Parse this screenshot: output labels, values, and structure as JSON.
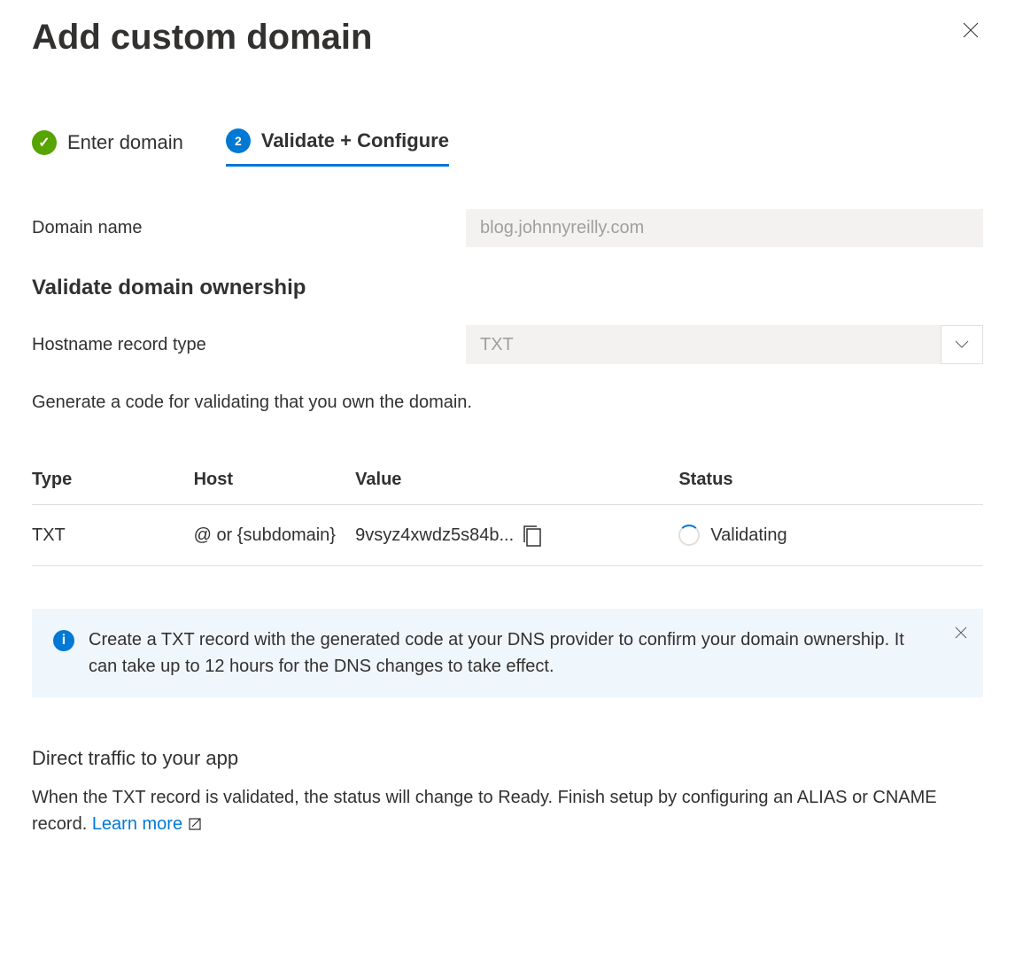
{
  "header": {
    "title": "Add custom domain"
  },
  "steps": {
    "step1_label": "Enter domain",
    "step2_number": "2",
    "step2_label": "Validate + Configure"
  },
  "form": {
    "domain_name_label": "Domain name",
    "domain_name_value": "blog.johnnyreilly.com",
    "validate_heading": "Validate domain ownership",
    "hostname_label": "Hostname record type",
    "hostname_value": "TXT",
    "generate_desc": "Generate a code for validating that you own the domain."
  },
  "table": {
    "headers": {
      "type": "Type",
      "host": "Host",
      "value": "Value",
      "status": "Status"
    },
    "row": {
      "type": "TXT",
      "host": "@ or {subdomain}",
      "value": "9vsyz4xwdz5s84b...",
      "status": "Validating"
    }
  },
  "info": {
    "text": "Create a TXT record with the generated code at your DNS provider to confirm your domain ownership. It can take up to 12 hours for the DNS changes to take effect."
  },
  "traffic": {
    "heading": "Direct traffic to your app",
    "desc_part1": "When the TXT record is validated, the status will change to Ready. Finish setup by configuring an ALIAS or CNAME record. ",
    "learn_more": "Learn more"
  }
}
